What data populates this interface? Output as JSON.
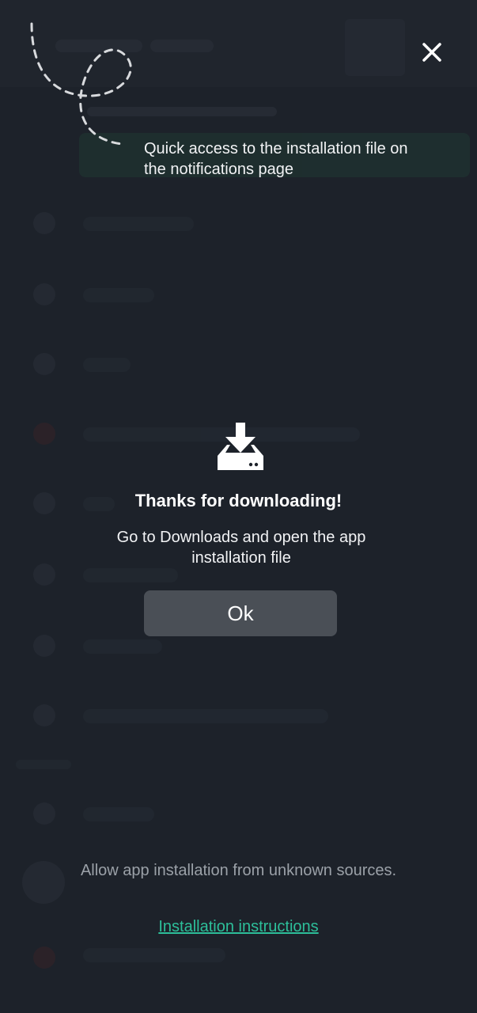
{
  "onboarding_hint": {
    "text": "Quick access to the installation file on the notifications page"
  },
  "modal": {
    "icon": "download-tray-icon",
    "title": "Thanks for downloading!",
    "subtitle": "Go to Downloads and open the app installation file",
    "ok_label": "Ok"
  },
  "footer": {
    "note": "Allow app installation from unknown sources.",
    "link_label": "Installation instructions"
  },
  "colors": {
    "background": "#1d222a",
    "button": "#4a4f56",
    "link": "#2dbf9a"
  }
}
